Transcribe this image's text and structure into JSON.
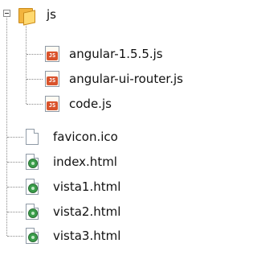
{
  "tree": {
    "folder": {
      "label": "js",
      "icon": "folder-open-icon",
      "expanded": true,
      "children": [
        {
          "label": "angular-1.5.5.js",
          "icon": "js-file-icon"
        },
        {
          "label": "angular-ui-router.js",
          "icon": "js-file-icon"
        },
        {
          "label": "code.js",
          "icon": "js-file-icon"
        }
      ]
    },
    "files": [
      {
        "label": "favicon.ico",
        "icon": "file-icon"
      },
      {
        "label": "index.html",
        "icon": "html-file-icon"
      },
      {
        "label": "vista1.html",
        "icon": "html-file-icon"
      },
      {
        "label": "vista2.html",
        "icon": "html-file-icon"
      },
      {
        "label": "vista3.html",
        "icon": "html-file-icon"
      }
    ]
  }
}
